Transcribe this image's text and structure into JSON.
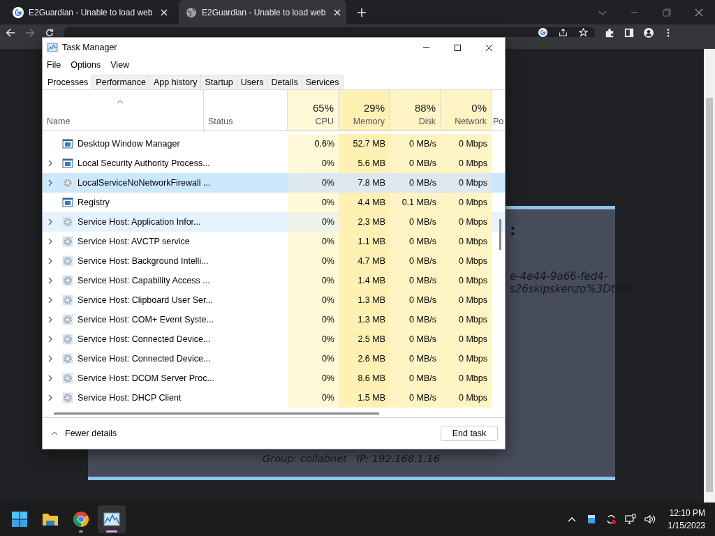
{
  "browser": {
    "tabs": [
      {
        "title": "E2Guardian - Unable to load web",
        "kind": "g",
        "selected": false
      },
      {
        "title": "E2Guardian - Unable to load web",
        "kind": "globe",
        "selected": true
      }
    ]
  },
  "page": {
    "colon": ":",
    "lines": [
      "e-4e44-9a66-fed4-",
      "s26skipskenzo%3Dtrue"
    ],
    "group": "Group: collabnet",
    "ip": "IP: 192.168.1.16"
  },
  "task_manager": {
    "title": "Task Manager",
    "menu": [
      "File",
      "Options",
      "View"
    ],
    "tabs": [
      {
        "label": "Processes",
        "selected": true
      },
      {
        "label": "Performance",
        "selected": false
      },
      {
        "label": "App history",
        "selected": false
      },
      {
        "label": "Startup",
        "selected": false
      },
      {
        "label": "Users",
        "selected": false
      },
      {
        "label": "Details",
        "selected": false
      },
      {
        "label": "Services",
        "selected": false
      }
    ],
    "columns": [
      {
        "label": "Name"
      },
      {
        "label": "Status"
      },
      {
        "label": "CPU",
        "percent": "65%"
      },
      {
        "label": "Memory",
        "percent": "29%"
      },
      {
        "label": "Disk",
        "percent": "88%"
      },
      {
        "label": "Network",
        "percent": "0%"
      },
      {
        "label": "Po"
      }
    ],
    "rows": [
      {
        "name": "Desktop Window Manager",
        "kind": "app",
        "expandable": false,
        "selected": false,
        "hover": false,
        "cpu": "0.6%",
        "memory": "52.7 MB",
        "disk": "0 MB/s",
        "network": "0 Mbps"
      },
      {
        "name": "Local Security Authority Process...",
        "kind": "app",
        "expandable": true,
        "selected": false,
        "hover": false,
        "cpu": "0%",
        "memory": "5.6 MB",
        "disk": "0 MB/s",
        "network": "0 Mbps"
      },
      {
        "name": "LocalServiceNoNetworkFirewall ...",
        "kind": "service",
        "expandable": true,
        "selected": true,
        "hover": false,
        "cpu": "0%",
        "memory": "7.8 MB",
        "disk": "0 MB/s",
        "network": "0 Mbps"
      },
      {
        "name": "Registry",
        "kind": "app",
        "expandable": false,
        "selected": false,
        "hover": false,
        "cpu": "0%",
        "memory": "4.4 MB",
        "disk": "0.1 MB/s",
        "network": "0 Mbps"
      },
      {
        "name": "Service Host: Application Infor...",
        "kind": "service",
        "expandable": true,
        "selected": false,
        "hover": true,
        "cpu": "0%",
        "memory": "2.3 MB",
        "disk": "0 MB/s",
        "network": "0 Mbps"
      },
      {
        "name": "Service Host: AVCTP service",
        "kind": "service",
        "expandable": true,
        "selected": false,
        "hover": false,
        "cpu": "0%",
        "memory": "1.1 MB",
        "disk": "0 MB/s",
        "network": "0 Mbps"
      },
      {
        "name": "Service Host: Background Intelli...",
        "kind": "service",
        "expandable": true,
        "selected": false,
        "hover": false,
        "cpu": "0%",
        "memory": "4.7 MB",
        "disk": "0 MB/s",
        "network": "0 Mbps"
      },
      {
        "name": "Service Host: Capability Access ...",
        "kind": "service",
        "expandable": true,
        "selected": false,
        "hover": false,
        "cpu": "0%",
        "memory": "1.4 MB",
        "disk": "0 MB/s",
        "network": "0 Mbps"
      },
      {
        "name": "Service Host: Clipboard User Ser...",
        "kind": "service",
        "expandable": true,
        "selected": false,
        "hover": false,
        "cpu": "0%",
        "memory": "1.3 MB",
        "disk": "0 MB/s",
        "network": "0 Mbps"
      },
      {
        "name": "Service Host: COM+ Event Syste...",
        "kind": "service",
        "expandable": true,
        "selected": false,
        "hover": false,
        "cpu": "0%",
        "memory": "1.3 MB",
        "disk": "0 MB/s",
        "network": "0 Mbps"
      },
      {
        "name": "Service Host: Connected Device...",
        "kind": "service",
        "expandable": true,
        "selected": false,
        "hover": false,
        "cpu": "0%",
        "memory": "2.5 MB",
        "disk": "0 MB/s",
        "network": "0 Mbps"
      },
      {
        "name": "Service Host: Connected Device...",
        "kind": "service",
        "expandable": true,
        "selected": false,
        "hover": false,
        "cpu": "0%",
        "memory": "2.6 MB",
        "disk": "0 MB/s",
        "network": "0 Mbps"
      },
      {
        "name": "Service Host: DCOM Server Proc...",
        "kind": "service",
        "expandable": true,
        "selected": false,
        "hover": false,
        "cpu": "0%",
        "memory": "8.6 MB",
        "disk": "0 MB/s",
        "network": "0 Mbps"
      },
      {
        "name": "Service Host: DHCP Client",
        "kind": "service",
        "expandable": true,
        "selected": false,
        "hover": false,
        "cpu": "0%",
        "memory": "1.5 MB",
        "disk": "0 MB/s",
        "network": "0 Mbps"
      }
    ],
    "footer": {
      "toggle": "Fewer details",
      "button": "End task"
    }
  },
  "taskbar": {
    "apps": [
      {
        "kind": "start",
        "running": false,
        "selected": false
      },
      {
        "kind": "explorer",
        "running": false,
        "selected": false
      },
      {
        "kind": "chrome",
        "running": true,
        "selected": false
      },
      {
        "kind": "taskmgr",
        "running": true,
        "selected": true
      }
    ],
    "time": "12:10 PM",
    "date": "1/15/2023"
  }
}
